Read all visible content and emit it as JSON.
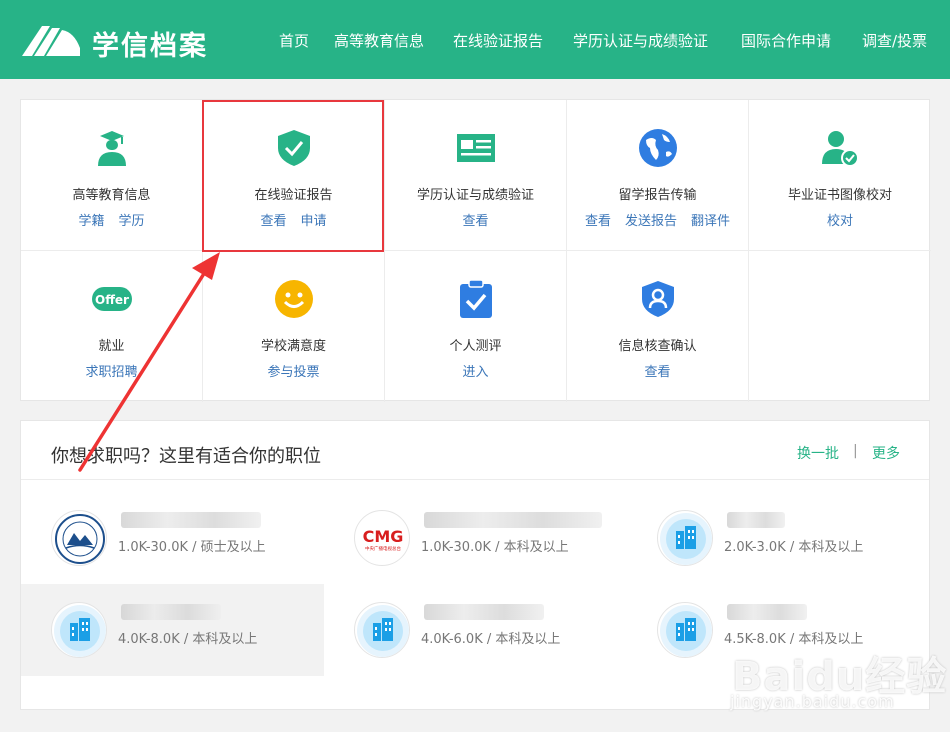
{
  "header": {
    "brand": "学信档案",
    "nav": [
      "首页",
      "高等教育信息",
      "在线验证报告",
      "学历认证与成绩验证",
      "国际合作申请",
      "调查/投票"
    ]
  },
  "services": [
    {
      "title": "高等教育信息",
      "links": [
        "学籍",
        "学历"
      ],
      "icon": "graduate-icon"
    },
    {
      "title": "在线验证报告",
      "links": [
        "查看",
        "申请"
      ],
      "icon": "shield-check-icon"
    },
    {
      "title": "学历认证与成绩验证",
      "links": [
        "查看"
      ],
      "icon": "id-card-icon"
    },
    {
      "title": "留学报告传输",
      "links": [
        "查看",
        "发送报告",
        "翻译件"
      ],
      "icon": "globe-icon"
    },
    {
      "title": "毕业证书图像校对",
      "links": [
        "校对"
      ],
      "icon": "user-check-icon"
    },
    {
      "title": "就业",
      "links": [
        "求职招聘"
      ],
      "icon": "offer-icon",
      "icon_text": "Offer"
    },
    {
      "title": "学校满意度",
      "links": [
        "参与投票"
      ],
      "icon": "smiley-icon"
    },
    {
      "title": "个人测评",
      "links": [
        "进入"
      ],
      "icon": "clipboard-check-icon"
    },
    {
      "title": "信息核查确认",
      "links": [
        "查看"
      ],
      "icon": "shield-user-icon"
    }
  ],
  "jobs": {
    "title": "你想求职吗？这里有适合你的职位",
    "refresh": "换一批",
    "separator": "|",
    "more": "更多",
    "items": [
      {
        "salary": "1.0K-30.0K",
        "degree": "硕士及以上",
        "logo": "university-seal-logo"
      },
      {
        "salary": "1.0K-30.0K",
        "degree": "本科及以上",
        "logo": "cmg-logo",
        "logo_text": "CMG",
        "logo_subtext": "中央广播电视总台"
      },
      {
        "salary": "2.0K-3.0K",
        "degree": "本科及以上",
        "logo": "building-icon"
      },
      {
        "salary": "4.0K-8.0K",
        "degree": "本科及以上",
        "logo": "building-icon"
      },
      {
        "salary": "4.0K-6.0K",
        "degree": "本科及以上",
        "logo": "building-icon"
      },
      {
        "salary": "4.5K-8.0K",
        "degree": "本科及以上",
        "logo": "building-icon"
      }
    ]
  },
  "watermark": {
    "text": "Baidu经验",
    "url": "jingyan.baidu.com"
  },
  "colors": {
    "brand": "#27b387",
    "link": "#3b76b8",
    "highlight": "#e8383d"
  }
}
